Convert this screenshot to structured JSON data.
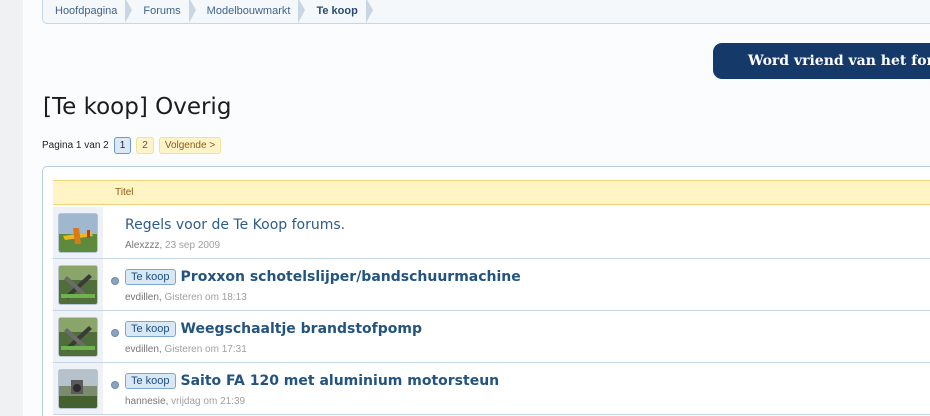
{
  "breadcrumb": [
    {
      "label": "Hoofdpagina"
    },
    {
      "label": "Forums"
    },
    {
      "label": "Modelbouwmarkt"
    },
    {
      "label": "Te koop"
    }
  ],
  "friend_button": {
    "label": "Word vriend van het forum,"
  },
  "page_title": "[Te koop] Overig",
  "pagination": {
    "label": "Pagina 1 van 2",
    "pages": [
      "1",
      "2"
    ],
    "current": "1",
    "next_label": "Volgende >"
  },
  "list": {
    "header_title": "Titel",
    "threads": [
      {
        "prefix": "",
        "title": "Regels voor de Te Koop forums.",
        "author": "Alexzzz",
        "date": "23 sep 2009",
        "avatar": "plane-photo"
      },
      {
        "prefix": "Te koop",
        "title": "Proxxon schotelslijper/bandschuurmachine",
        "author": "evdillen",
        "date": "Gisteren om 18:13",
        "avatar": "plane-photo"
      },
      {
        "prefix": "Te koop",
        "title": "Weegschaaltje brandstofpomp",
        "author": "evdillen",
        "date": "Gisteren om 17:31",
        "avatar": "plane-photo"
      },
      {
        "prefix": "Te koop",
        "title": "Saito FA 120 met aluminium motorsteun",
        "author": "hannesie",
        "date": "vrijdag om 21:39",
        "avatar": "field-photo"
      }
    ]
  },
  "colors": {
    "accent": "#153a6a",
    "link": "#23547f",
    "header_bg": "#fff4c4"
  }
}
